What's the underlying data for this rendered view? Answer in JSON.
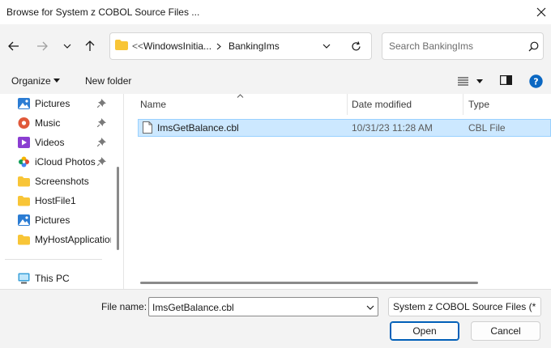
{
  "window": {
    "title": "Browse for System z COBOL Source Files ..."
  },
  "address": {
    "overflow": "<<",
    "crumbs": [
      "WindowsInitia...",
      "BankingIms"
    ]
  },
  "search": {
    "placeholder": "Search BankingIms"
  },
  "toolbar": {
    "organize_label": "Organize",
    "new_folder_label": "New folder"
  },
  "nav_pane": {
    "items": [
      {
        "label": "Pictures",
        "icon": "pictures-icon",
        "pinned": true
      },
      {
        "label": "Music",
        "icon": "music-icon",
        "pinned": true
      },
      {
        "label": "Videos",
        "icon": "videos-icon",
        "pinned": true
      },
      {
        "label": "iCloud Photos",
        "icon": "icloud-photos-icon",
        "pinned": true
      },
      {
        "label": "Screenshots",
        "icon": "folder-icon",
        "pinned": false
      },
      {
        "label": "HostFile1",
        "icon": "folder-icon",
        "pinned": false
      },
      {
        "label": "Pictures",
        "icon": "pictures-icon",
        "pinned": false
      },
      {
        "label": "MyHostApplication",
        "icon": "folder-icon",
        "pinned": false
      }
    ],
    "this_pc": "This PC"
  },
  "file_list": {
    "columns": {
      "name": "Name",
      "date": "Date modified",
      "type": "Type"
    },
    "rows": [
      {
        "name": "ImsGetBalance.cbl",
        "date": "10/31/23 11:28 AM",
        "type": "CBL File",
        "selected": true
      }
    ]
  },
  "bottom": {
    "file_name_label": "File name:",
    "file_name_value": "ImsGetBalance.cbl",
    "file_type_value": "System z COBOL Source Files (*",
    "open_label": "Open",
    "cancel_label": "Cancel"
  },
  "colors": {
    "accent": "#005fb8",
    "selection": "#cce8ff",
    "folder": "#f8c537",
    "help": "#0a67c2"
  }
}
